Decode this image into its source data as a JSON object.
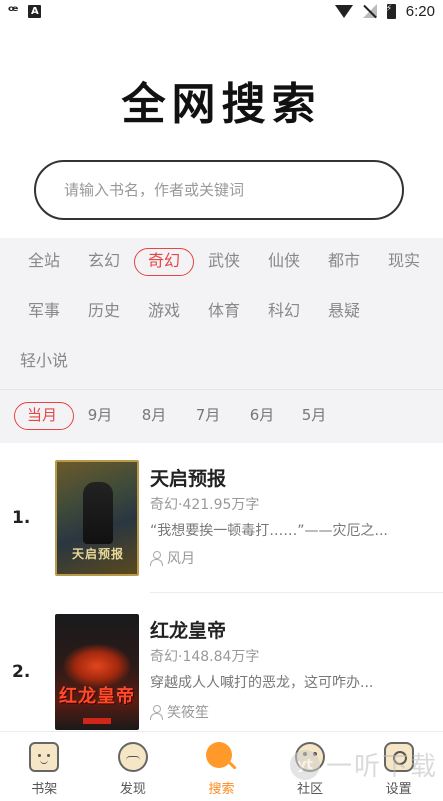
{
  "status_bar": {
    "time": "6:20",
    "icons": [
      "app-logo-icon",
      "a-notification-icon",
      "wifi-icon",
      "no-signal-icon",
      "battery-charging-icon"
    ]
  },
  "page": {
    "title": "全网搜索"
  },
  "search": {
    "placeholder": "请输入书名，作者或关键词"
  },
  "categories": {
    "selected": "奇幻",
    "items": [
      "全站",
      "玄幻",
      "奇幻",
      "武侠",
      "仙侠",
      "都市",
      "现实",
      "军事",
      "历史",
      "游戏",
      "体育",
      "科幻",
      "悬疑",
      "轻小说"
    ]
  },
  "months": {
    "selected": "当月",
    "items": [
      "当月",
      "9月",
      "8月",
      "7月",
      "6月",
      "5月"
    ]
  },
  "books": [
    {
      "rank": "1.",
      "title": "天启预报",
      "meta": "奇幻·421.95万字",
      "desc": "“我想要挨一顿毒打……”——灾厄之...",
      "author": "风月",
      "cover_title": "天启预报"
    },
    {
      "rank": "2.",
      "title": "红龙皇帝",
      "meta": "奇幻·148.84万字",
      "desc": "穿越成人人喊打的恶龙，这可咋办...",
      "author": "笑筱笙",
      "cover_title": "红龙皇帝"
    }
  ],
  "bottom_nav": {
    "active": "搜索",
    "items": [
      {
        "label": "书架",
        "icon": "bookshelf-icon"
      },
      {
        "label": "发现",
        "icon": "discover-icon"
      },
      {
        "label": "搜索",
        "icon": "search-icon"
      },
      {
        "label": "社区",
        "icon": "community-icon"
      },
      {
        "label": "设置",
        "icon": "settings-icon"
      }
    ]
  },
  "watermark": {
    "logo": "yt",
    "text": "一听下载"
  },
  "colors": {
    "accent_red": "#e64545",
    "accent_orange": "#ff8a1e",
    "panel_bg": "#f3f3f5"
  }
}
